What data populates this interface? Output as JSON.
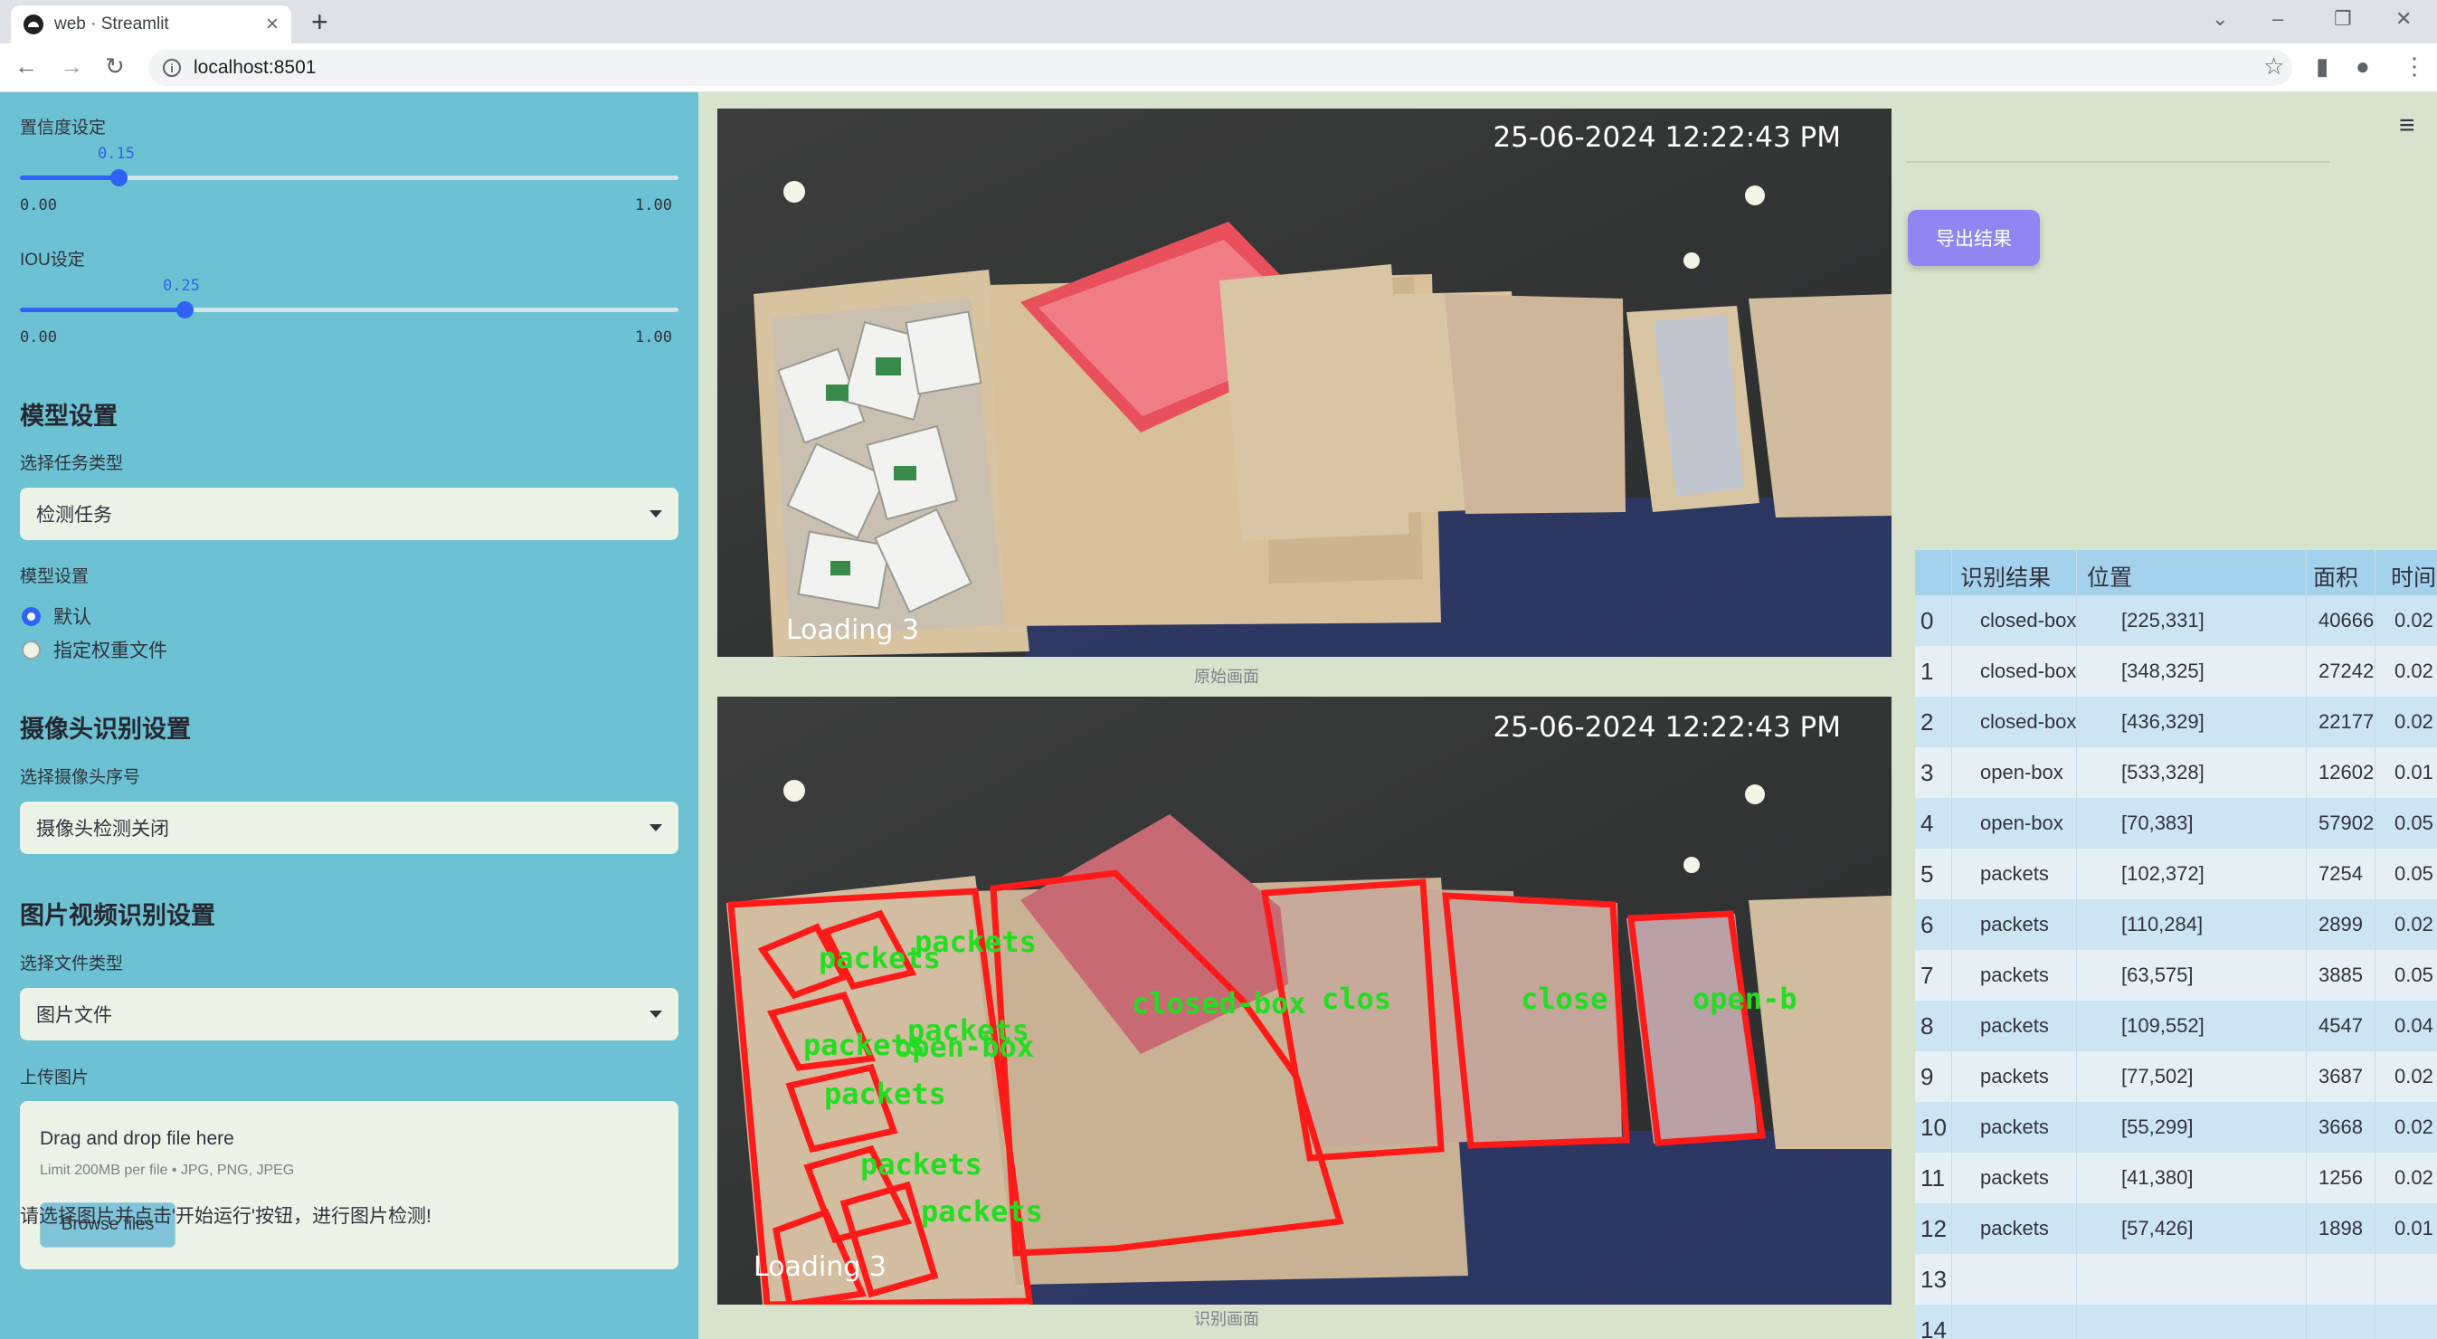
{
  "browser": {
    "tab_title": "web · Streamlit",
    "url": "localhost:8501"
  },
  "sidebar": {
    "confidence": {
      "label": "置信度设定",
      "value": 0.15,
      "value_text": "0.15",
      "min": "0.00",
      "max": "1.00"
    },
    "iou": {
      "label": "IOU设定",
      "value": 0.25,
      "value_text": "0.25",
      "min": "0.00",
      "max": "1.00"
    },
    "model_header": "模型设置",
    "task_type_label": "选择任务类型",
    "task_type_value": "检测任务",
    "model_setting_label": "模型设置",
    "model_options": [
      "默认",
      "指定权重文件"
    ],
    "camera_header": "摄像头识别设置",
    "camera_select_label": "选择摄像头序号",
    "camera_select_value": "摄像头检测关闭",
    "media_header": "图片视频识别设置",
    "file_type_label": "选择文件类型",
    "file_type_value": "图片文件",
    "upload_label": "上传图片",
    "uploader_title": "Drag and drop file here",
    "uploader_limit": "Limit 200MB per file • JPG, PNG, JPEG",
    "browse_label": "Browse files",
    "hint": "请选择图片并点击'开始运行'按钮，进行图片检测!"
  },
  "main": {
    "timestamp": "25-06-2024 12:22:43 PM",
    "overlay_top": "Loading 3",
    "overlay_bottom": "Loading 3",
    "caption_original": "原始画面",
    "caption_result": "识别画面",
    "export_label": "导出结果",
    "det_labels": [
      "packets",
      "packets",
      "packets",
      "packets",
      "packets",
      "packets",
      "packets",
      "closed-box",
      "clos",
      "close",
      "open-b",
      "open-box"
    ],
    "colors": {
      "box": "#ff1a1a",
      "label": "#22dd22",
      "accent": "#8f86f2"
    }
  },
  "results": {
    "columns": [
      "识别结果",
      "位置",
      "面积",
      "时间"
    ],
    "rows": [
      {
        "idx": "0",
        "cls": "closed-box",
        "pos": "[225,331]",
        "area": "40666",
        "time": "0.02"
      },
      {
        "idx": "1",
        "cls": "closed-box",
        "pos": "[348,325]",
        "area": "27242",
        "time": "0.02"
      },
      {
        "idx": "2",
        "cls": "closed-box",
        "pos": "[436,329]",
        "area": "22177",
        "time": "0.02"
      },
      {
        "idx": "3",
        "cls": "open-box",
        "pos": "[533,328]",
        "area": "12602",
        "time": "0.01"
      },
      {
        "idx": "4",
        "cls": "open-box",
        "pos": "[70,383]",
        "area": "57902",
        "time": "0.05"
      },
      {
        "idx": "5",
        "cls": "packets",
        "pos": "[102,372]",
        "area": "7254",
        "time": "0.05"
      },
      {
        "idx": "6",
        "cls": "packets",
        "pos": "[110,284]",
        "area": "2899",
        "time": "0.02"
      },
      {
        "idx": "7",
        "cls": "packets",
        "pos": "[63,575]",
        "area": "3885",
        "time": "0.05"
      },
      {
        "idx": "8",
        "cls": "packets",
        "pos": "[109,552]",
        "area": "4547",
        "time": "0.04"
      },
      {
        "idx": "9",
        "cls": "packets",
        "pos": "[77,502]",
        "area": "3687",
        "time": "0.02"
      },
      {
        "idx": "10",
        "cls": "packets",
        "pos": "[55,299]",
        "area": "3668",
        "time": "0.02"
      },
      {
        "idx": "11",
        "cls": "packets",
        "pos": "[41,380]",
        "area": "1256",
        "time": "0.02"
      },
      {
        "idx": "12",
        "cls": "packets",
        "pos": "[57,426]",
        "area": "1898",
        "time": "0.01"
      },
      {
        "idx": "13",
        "cls": "",
        "pos": "",
        "area": "",
        "time": ""
      },
      {
        "idx": "14",
        "cls": "",
        "pos": "",
        "area": "",
        "time": ""
      }
    ]
  }
}
